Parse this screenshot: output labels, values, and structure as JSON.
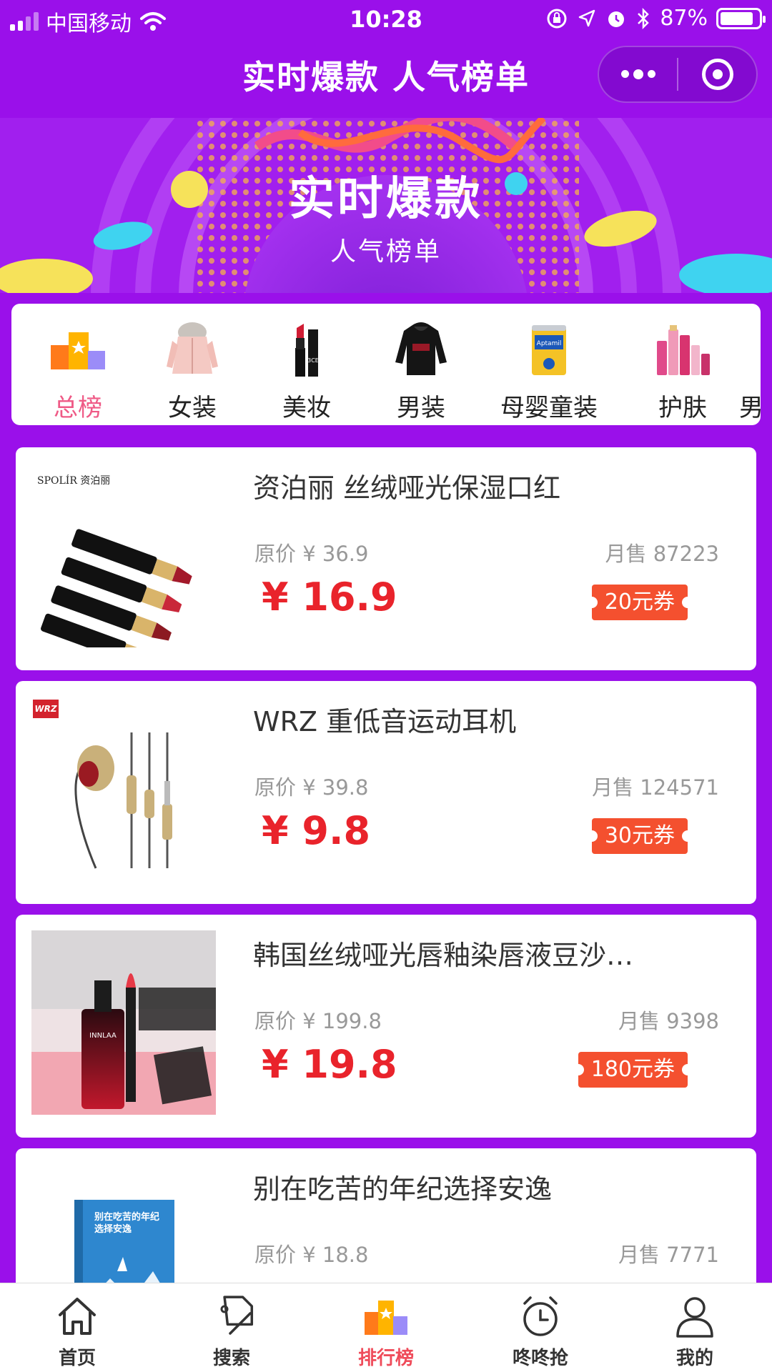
{
  "status_bar": {
    "carrier": "中国移动",
    "time": "10:28",
    "battery": "87%",
    "battery_level": 0.87
  },
  "nav": {
    "title": "实时爆款 人气榜单",
    "more_icon": "more-dots-icon",
    "close_icon": "target-circle-icon"
  },
  "banner": {
    "title": "实时爆款",
    "subtitle": "人气榜单"
  },
  "categories": [
    {
      "label": "总榜",
      "icon": "ranking-podium-icon",
      "active": true
    },
    {
      "label": "女装",
      "icon": "womens-coat-icon",
      "active": false
    },
    {
      "label": "美妆",
      "icon": "lipstick-icon",
      "active": false
    },
    {
      "label": "男装",
      "icon": "hoodie-icon",
      "active": false
    },
    {
      "label": "母婴童装",
      "icon": "formula-can-icon",
      "active": false
    },
    {
      "label": "护肤",
      "icon": "skincare-bottles-icon",
      "active": false
    },
    {
      "label": "男",
      "icon": "",
      "active": false
    }
  ],
  "products": [
    {
      "title": "资泊丽 丝绒哑光保湿口红",
      "original_price": "原价 ¥ 36.9",
      "sales": "月售 87223",
      "price": "¥ 16.9",
      "coupon": "20元券",
      "brand_mark": "SPOLÍR 资泊丽"
    },
    {
      "title": "WRZ 重低音运动耳机",
      "original_price": "原价 ¥ 39.8",
      "sales": "月售 124571",
      "price": "¥ 9.8",
      "coupon": "30元券",
      "brand_mark": "WRZ"
    },
    {
      "title": "韩国丝绒哑光唇釉染唇液豆沙…",
      "original_price": "原价 ¥ 199.8",
      "sales": "月售 9398",
      "price": "¥ 19.8",
      "coupon": "180元券",
      "brand_mark": "INNLAA"
    },
    {
      "title": "别在吃苦的年纪选择安逸",
      "original_price": "原价 ¥ 18.8",
      "sales": "月售 7771",
      "price": "",
      "coupon": "",
      "brand_mark": "别在吃苦的年纪选择安逸"
    }
  ],
  "tabbar": [
    {
      "label": "首页",
      "icon": "home-icon",
      "active": false
    },
    {
      "label": "搜索",
      "icon": "tag-icon",
      "active": false
    },
    {
      "label": "排行榜",
      "icon": "ranking-podium-icon",
      "active": true
    },
    {
      "label": "咚咚抢",
      "icon": "alarm-clock-icon",
      "active": false
    },
    {
      "label": "我的",
      "icon": "user-icon",
      "active": false
    }
  ],
  "colors": {
    "background": "#9a10ea",
    "price_red": "#e9232b",
    "coupon": "#f4502f",
    "active_pink": "#ef5a86",
    "active_tab": "#ef4b5a"
  }
}
